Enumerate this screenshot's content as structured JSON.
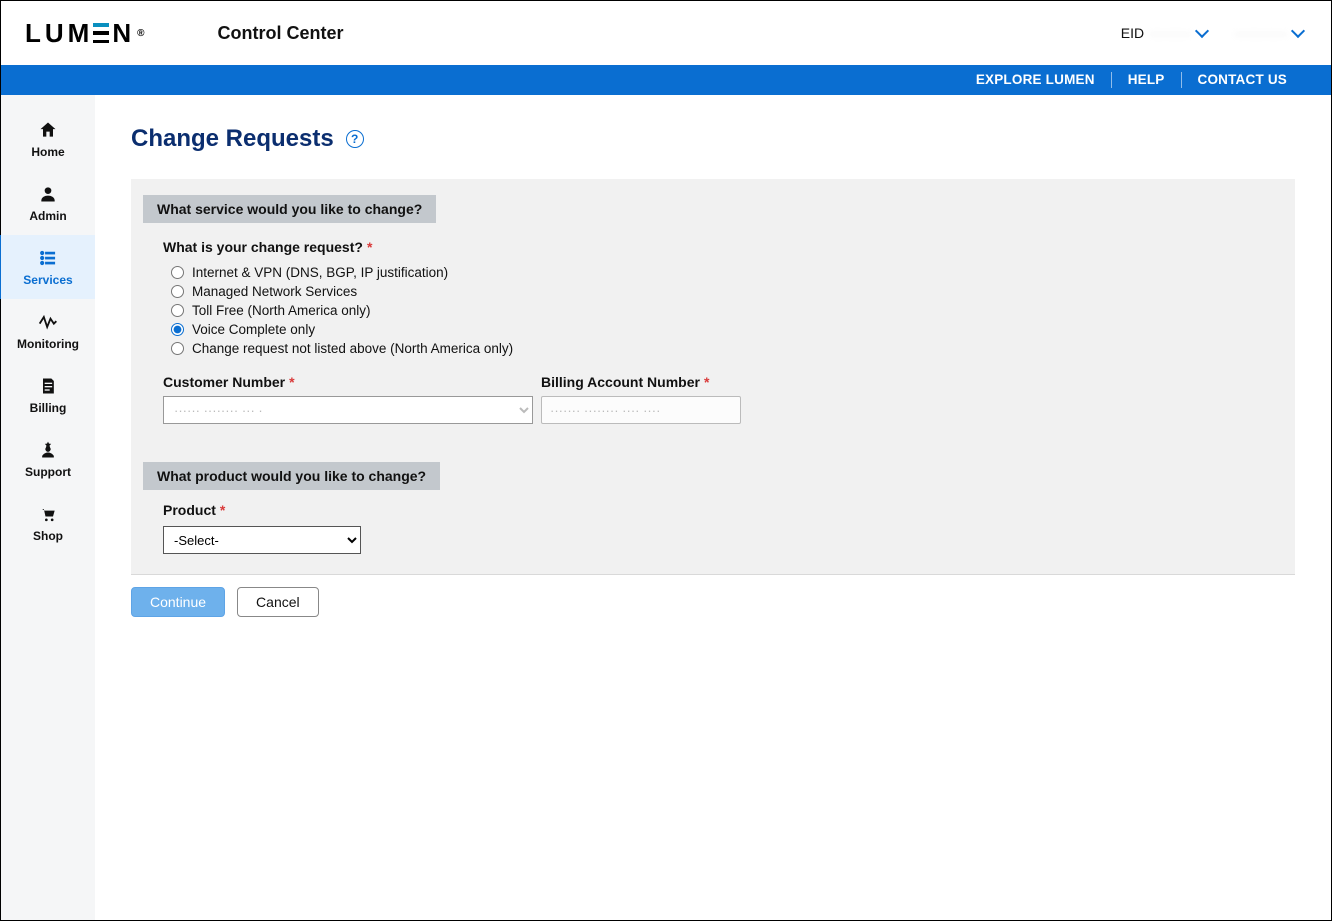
{
  "header": {
    "brand_text": "LUMEN",
    "app_title": "Control Center",
    "eid_label": "EID",
    "eid_value": "········",
    "user_value": "··········"
  },
  "bluebar": {
    "explore": "EXPLORE LUMEN",
    "help": "HELP",
    "contact": "CONTACT US"
  },
  "sidebar": {
    "home": "Home",
    "admin": "Admin",
    "services": "Services",
    "monitoring": "Monitoring",
    "billing": "Billing",
    "support": "Support",
    "shop": "Shop",
    "active": "services"
  },
  "page": {
    "title": "Change Requests"
  },
  "form": {
    "section1_title": "What service would you like to change?",
    "question_label": "What is your change request?",
    "options": {
      "internet_vpn": "Internet & VPN (DNS, BGP, IP justification)",
      "managed": "Managed Network Services",
      "toll_free": "Toll Free (North America only)",
      "voice_complete": "Voice Complete only",
      "not_listed": "Change request not listed above (North America only)"
    },
    "selected_option": "voice_complete",
    "customer_label": "Customer Number",
    "customer_value": "······ ········ ··· ·",
    "billing_label": "Billing Account Number",
    "billing_value": "······· ········ ···· ····",
    "section2_title": "What product would you like to change?",
    "product_label": "Product",
    "product_placeholder": "-Select-"
  },
  "actions": {
    "continue": "Continue",
    "cancel": "Cancel"
  }
}
